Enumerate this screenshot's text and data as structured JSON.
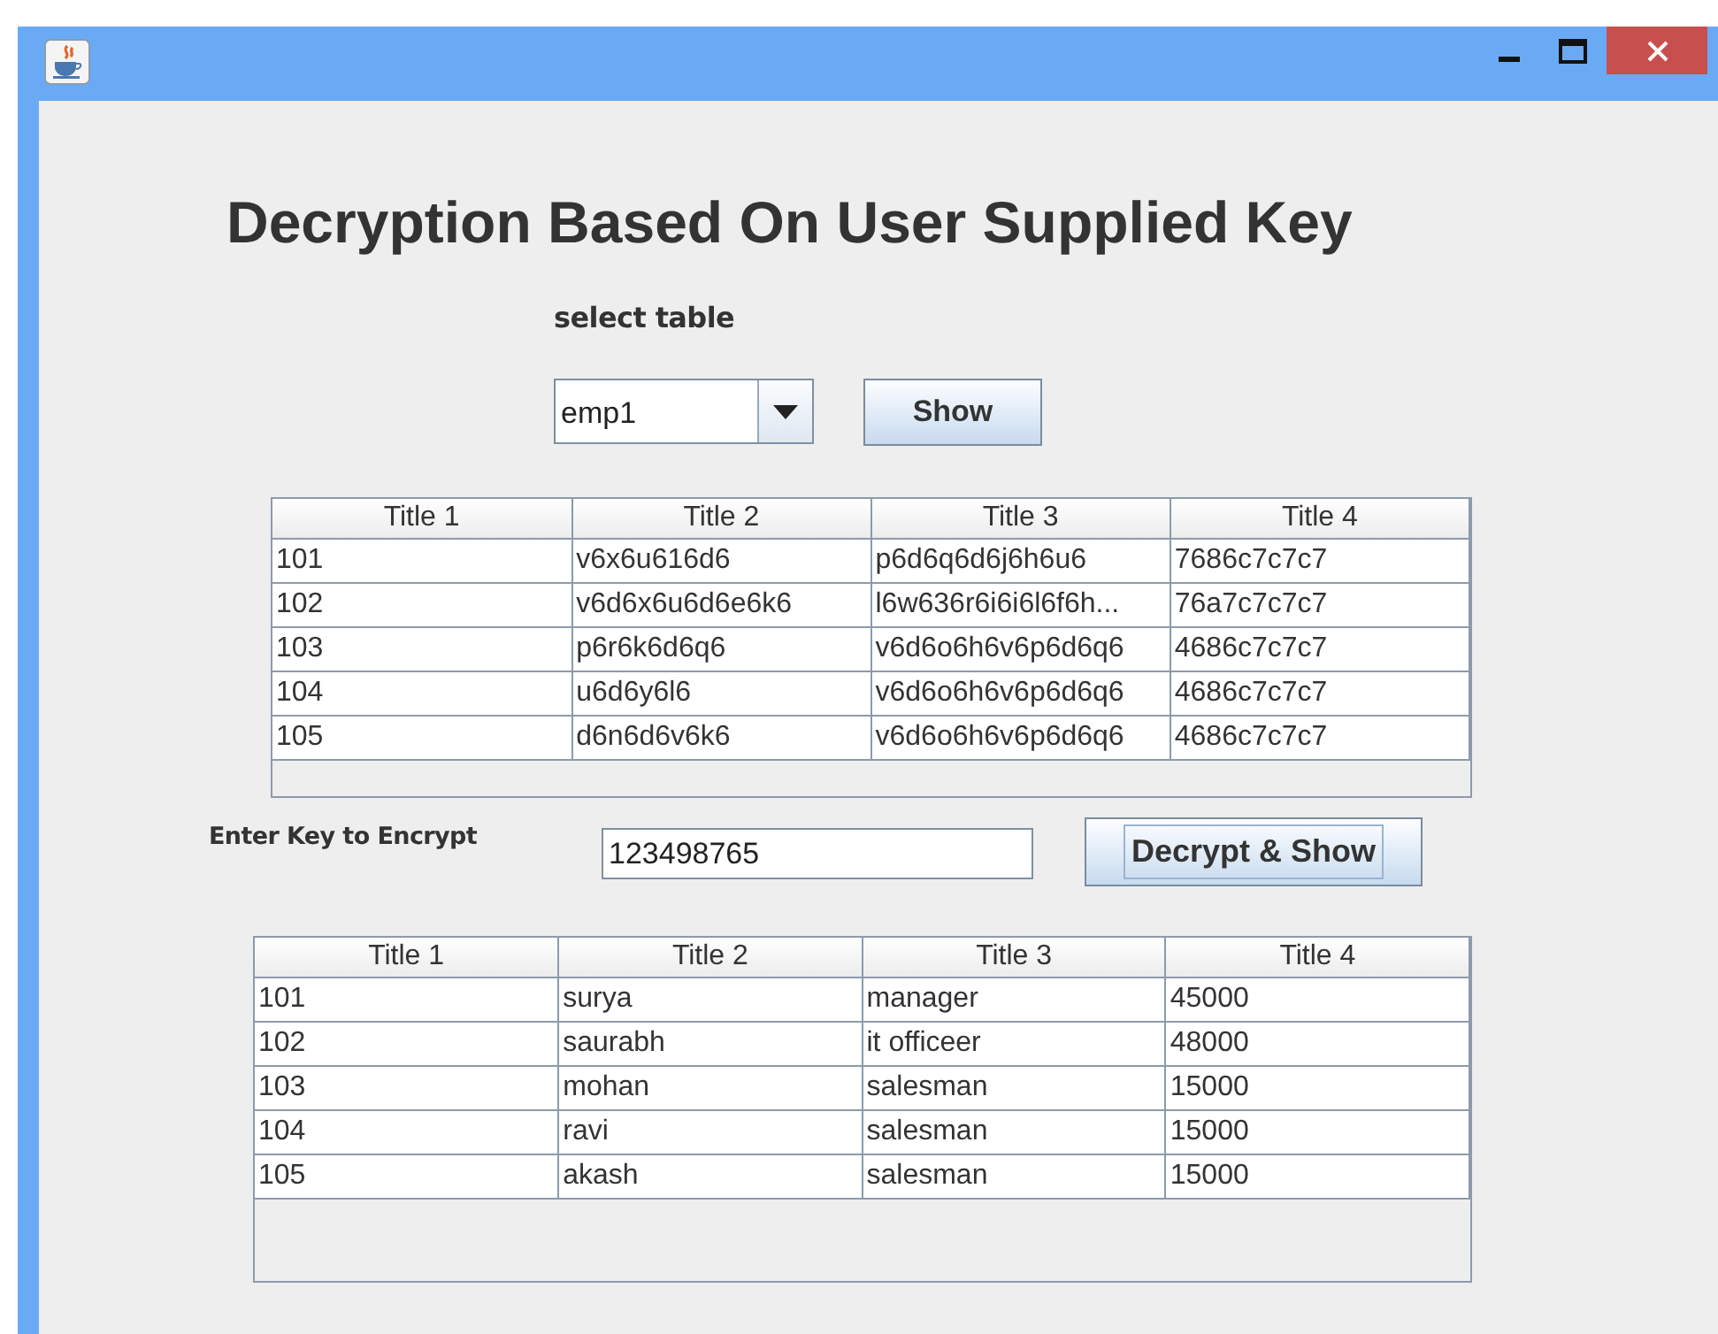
{
  "heading": "Decryption Based On User Supplied Key",
  "select_label": "select table",
  "table_select": {
    "value": "emp1"
  },
  "show_button": {
    "label": "Show",
    "focused": false
  },
  "encrypted_table": {
    "columns": [
      "Title 1",
      "Title 2",
      "Title 3",
      "Title 4"
    ],
    "rows": [
      [
        "101",
        "v6x6u616d6",
        "p6d6q6d6j6h6u6",
        "7686c7c7c7"
      ],
      [
        "102",
        "v6d6x6u6d6e6k6",
        "l6w636r6i6i6l6f6h...",
        "76a7c7c7c7"
      ],
      [
        "103",
        "p6r6k6d6q6",
        "v6d6o6h6v6p6d6q6",
        "4686c7c7c7"
      ],
      [
        "104",
        "u6d6y6l6",
        "v6d6o6h6v6p6d6q6",
        "4686c7c7c7"
      ],
      [
        "105",
        "d6n6d6v6k6",
        "v6d6o6h6v6p6d6q6",
        "4686c7c7c7"
      ]
    ]
  },
  "key_label": "Enter Key to Encrypt",
  "key_field": {
    "value": "123498765"
  },
  "decrypt_button": {
    "label": "Decrypt & Show",
    "focused": true
  },
  "decrypted_table": {
    "columns": [
      "Title 1",
      "Title 2",
      "Title 3",
      "Title 4"
    ],
    "rows": [
      [
        "101",
        "surya",
        "manager",
        "45000"
      ],
      [
        "102",
        "saurabh",
        "it officeer",
        "48000"
      ],
      [
        "103",
        "mohan",
        "salesman",
        "15000"
      ],
      [
        "104",
        "ravi",
        "salesman",
        "15000"
      ],
      [
        "105",
        "akash",
        "salesman",
        "15000"
      ]
    ]
  }
}
